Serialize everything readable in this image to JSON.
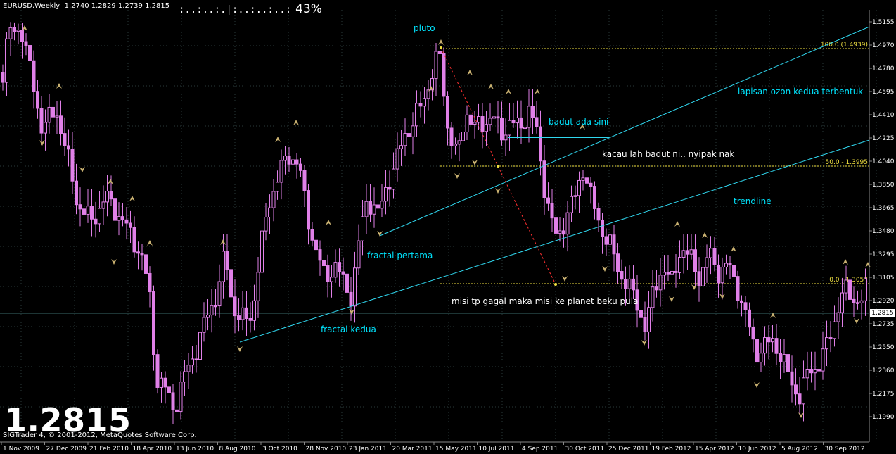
{
  "header": {
    "symbol_title": "EURUSD,Weekly  1.2740 1.2829 1.2739 1.2815",
    "progress_bar": ":..:..:.|:..:..:..:",
    "progress_text": "43%",
    "progress_value": 0.43
  },
  "price_display": "1.2815",
  "copyright": "SIGTrader 4, © 2001-2012, MetaQuotes Software Corp.",
  "current_price_label": "1.2815",
  "colors": {
    "background": "#000000",
    "candle": "#e080e8",
    "trendline": "#30d8f0",
    "fractal": "#c8b070",
    "fibo": "#f0e040",
    "grid": "#2a3a3a",
    "projection": "#ff3030"
  },
  "price_axis": [
    "1.5155",
    "1.4970",
    "1.4780",
    "1.4595",
    "1.4410",
    "1.4225",
    "1.4040",
    "1.3850",
    "1.3665",
    "1.3480",
    "1.3295",
    "1.3105",
    "1.2920",
    "1.2735",
    "1.2550",
    "1.2360",
    "1.2175",
    "1.1990"
  ],
  "time_axis": [
    "1 Nov 2009",
    "27 Dec 2009",
    "21 Feb 2010",
    "18 Apr 2010",
    "13 Jun 2010",
    "8 Aug 2010",
    "3 Oct 2010",
    "28 Nov 2010",
    "23 Jan 2011",
    "20 Mar 2011",
    "15 May 2011",
    "10 Jul 2011",
    "4 Sep 2011",
    "30 Oct 2011",
    "25 Dec 2011",
    "19 Feb 2012",
    "15 Apr 2012",
    "10 Jun 2012",
    "5 Aug 2012",
    "30 Sep 2012"
  ],
  "fibo_levels": [
    "100.0 (1.4939)",
    "50.0 - 1.3995",
    "0.0 - 1.3052"
  ],
  "annotations": {
    "pluto": "pluto",
    "ozon": "lapisan ozon kedua terbentuk",
    "badut": "badut ada sini",
    "kacau": "kacau lah badut ni.. nyipak nak",
    "trendline": "trendline",
    "fractal_pertama": "fractal pertama",
    "misi": "misi tp gagal maka misi ke planet beku pula",
    "fractal_kedua": "fractal kedua"
  }
}
